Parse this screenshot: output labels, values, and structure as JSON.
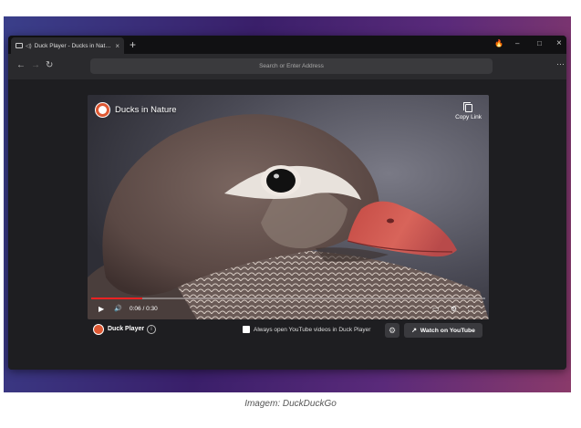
{
  "browser": {
    "tab_title": "Duck Player - Ducks in Nature",
    "tab_close": "×",
    "new_tab": "+",
    "fire_icon": "🔥",
    "minimize": "–",
    "maximize": "□",
    "close": "×",
    "back": "←",
    "forward": "→",
    "reload": "↻",
    "address_placeholder": "Search or Enter Address",
    "menu": "···"
  },
  "video": {
    "channel_name": "Ducks in Nature",
    "copy_link_label": "Copy Link",
    "time": "0:06 / 0:30",
    "progress": 0.13,
    "play": "▶",
    "volume": "🔊",
    "cc": "▭",
    "settings": "⚙",
    "fullscreen": "⛶"
  },
  "duck_player_bar": {
    "label": "Duck Player",
    "info": "i",
    "always_open_label": "Always open YouTube videos in Duck Player",
    "gear": "⚙",
    "watch_label": "Watch on YouTube",
    "watch_icon": "↗"
  },
  "caption": "Imagem: DuckDuckGo",
  "colors": {
    "accent": "#de5833",
    "progress": "#e22222"
  }
}
